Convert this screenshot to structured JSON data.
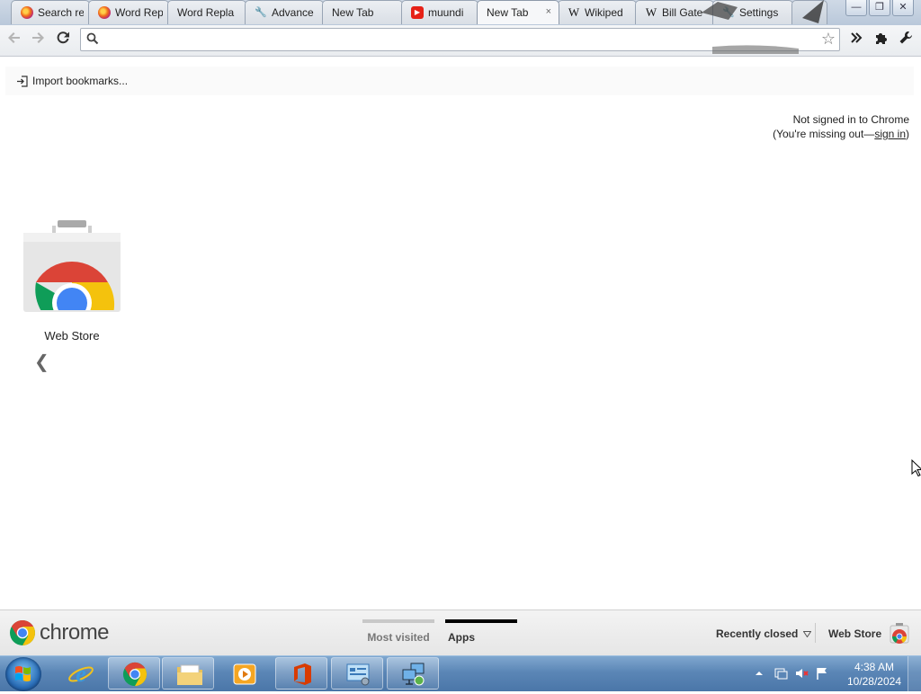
{
  "tabs": [
    {
      "label": "Search re",
      "icon": "firefox-icon",
      "active": false
    },
    {
      "label": "Word Rep",
      "icon": "firefox-icon",
      "active": false
    },
    {
      "label": "Word Repla",
      "icon": "",
      "active": false
    },
    {
      "label": "Advance",
      "icon": "wrench-icon",
      "active": false
    },
    {
      "label": "New Tab",
      "icon": "",
      "active": false
    },
    {
      "label": "muundi",
      "icon": "youtube-icon",
      "active": false
    },
    {
      "label": "New Tab",
      "icon": "",
      "active": true,
      "close": "×"
    },
    {
      "label": "Wikiped",
      "icon": "wikipedia-icon",
      "active": false
    },
    {
      "label": "Bill Gate",
      "icon": "wikipedia-icon",
      "active": false
    },
    {
      "label": "Settings",
      "icon": "wrench-icon",
      "active": false
    }
  ],
  "toolbar": {
    "omnibox_value": ""
  },
  "bookmark_bar": {
    "import_label": "Import bookmarks..."
  },
  "signin": {
    "line1": "Not signed in to Chrome",
    "line2_prefix": "(You're missing out—",
    "link": "sign in",
    "line2_suffix": ")"
  },
  "apps": [
    {
      "label": "Web Store"
    }
  ],
  "footer": {
    "brand": "chrome",
    "pager_most_visited": "Most visited",
    "pager_apps": "Apps",
    "recently_closed": "Recently closed",
    "web_store": "Web Store"
  },
  "taskbar": {
    "time": "4:38 AM",
    "date": "10/28/2024"
  },
  "colors": {
    "chrome_red": "#db4437",
    "chrome_yellow": "#f4c20d",
    "chrome_green": "#0f9d58",
    "chrome_blue": "#4285f4",
    "taskbar": "#5b86b6"
  }
}
